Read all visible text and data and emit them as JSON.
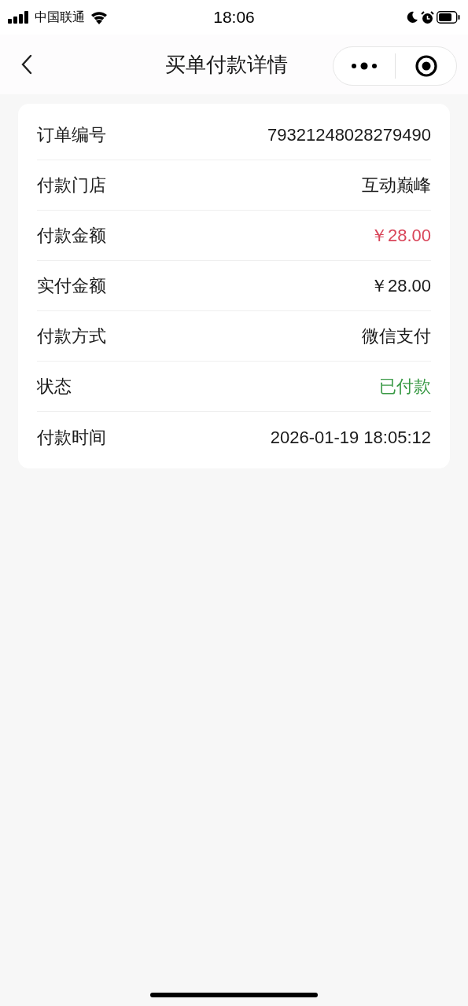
{
  "status_bar": {
    "carrier": "中国联通",
    "time": "18:06"
  },
  "nav": {
    "title": "买单付款详情"
  },
  "rows": [
    {
      "label": "订单编号",
      "value": "79321248028279490",
      "kind": "plain"
    },
    {
      "label": "付款门店",
      "value": "互动巅峰",
      "kind": "plain"
    },
    {
      "label": "付款金额",
      "value": "￥28.00",
      "kind": "alert"
    },
    {
      "label": "实付金额",
      "value": "￥28.00",
      "kind": "plain"
    },
    {
      "label": "付款方式",
      "value": "微信支付",
      "kind": "plain"
    },
    {
      "label": "状态",
      "value": "已付款",
      "kind": "success"
    },
    {
      "label": "付款时间",
      "value": "2026-01-19 18:05:12",
      "kind": "plain"
    }
  ]
}
